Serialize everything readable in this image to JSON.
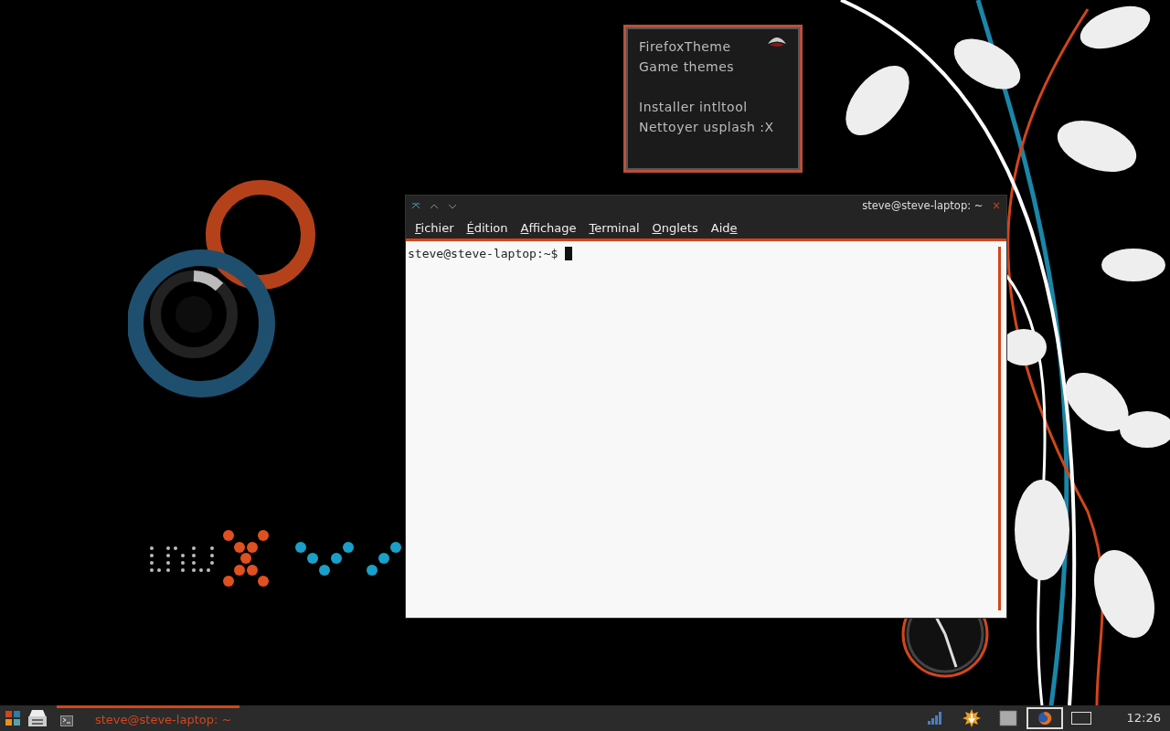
{
  "note": {
    "groups": [
      [
        "FirefoxTheme",
        "Game themes"
      ],
      [
        "Installer intltool",
        "Nettoyer usplash :X"
      ]
    ]
  },
  "terminal": {
    "title": "steve@steve-laptop: ~",
    "close": "×",
    "menu": [
      {
        "parts": [
          {
            "text": "F",
            "underlined": true
          },
          {
            "text": "ichier",
            "underlined": false
          }
        ]
      },
      {
        "parts": [
          {
            "text": "É",
            "underlined": true
          },
          {
            "text": "dition",
            "underlined": false
          }
        ]
      },
      {
        "parts": [
          {
            "text": "A",
            "underlined": true
          },
          {
            "text": "ffichage",
            "underlined": false
          }
        ]
      },
      {
        "parts": [
          {
            "text": "T",
            "underlined": true
          },
          {
            "text": "erminal",
            "underlined": false
          }
        ]
      },
      {
        "parts": [
          {
            "text": "O",
            "underlined": true
          },
          {
            "text": "nglets",
            "underlined": false
          }
        ]
      },
      {
        "parts": [
          {
            "text": "Aid",
            "underlined": false
          },
          {
            "text": "e",
            "underlined": true
          }
        ]
      }
    ],
    "prompt": "steve@steve-laptop:~$"
  },
  "taskbar": {
    "tasks": [
      {
        "label": "steve@steve-laptop: ~",
        "selected": true
      }
    ],
    "tray": [
      {
        "kind": "signal"
      },
      {
        "kind": "update"
      },
      {
        "kind": "chip"
      },
      {
        "kind": "browser",
        "selected": true
      },
      {
        "kind": "desktop",
        "selected": false
      }
    ],
    "clock": "12:26"
  }
}
